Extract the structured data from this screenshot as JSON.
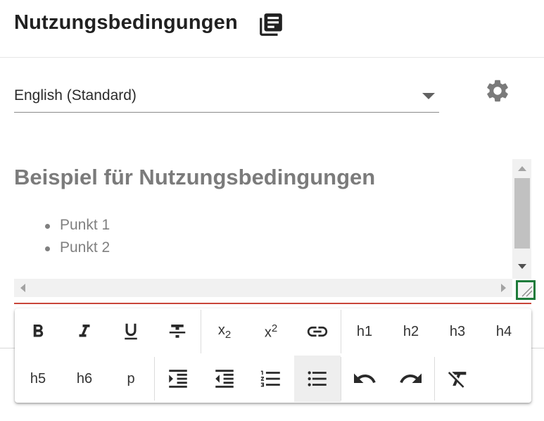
{
  "header": {
    "title": "Nutzungsbedingungen",
    "icon": "library-books-icon"
  },
  "language": {
    "selected": "English (Standard)"
  },
  "settings": {
    "icon": "gear-icon"
  },
  "editor": {
    "heading": "Beispiel für Nutzungsbedingungen",
    "list": [
      "Punkt 1",
      "Punkt 2"
    ]
  },
  "toolbar": {
    "row1": {
      "subscript": {
        "base": "x",
        "script": "2"
      },
      "superscript": {
        "base": "x",
        "script": "2"
      },
      "h1": "h1",
      "h2": "h2",
      "h3": "h3",
      "h4": "h4"
    },
    "row2": {
      "h5": "h5",
      "h6": "h6",
      "p": "p"
    },
    "active": "bullet-list-button"
  },
  "colors": {
    "accent_error": "#c9463a",
    "focus_green": "#1e7b3a"
  }
}
